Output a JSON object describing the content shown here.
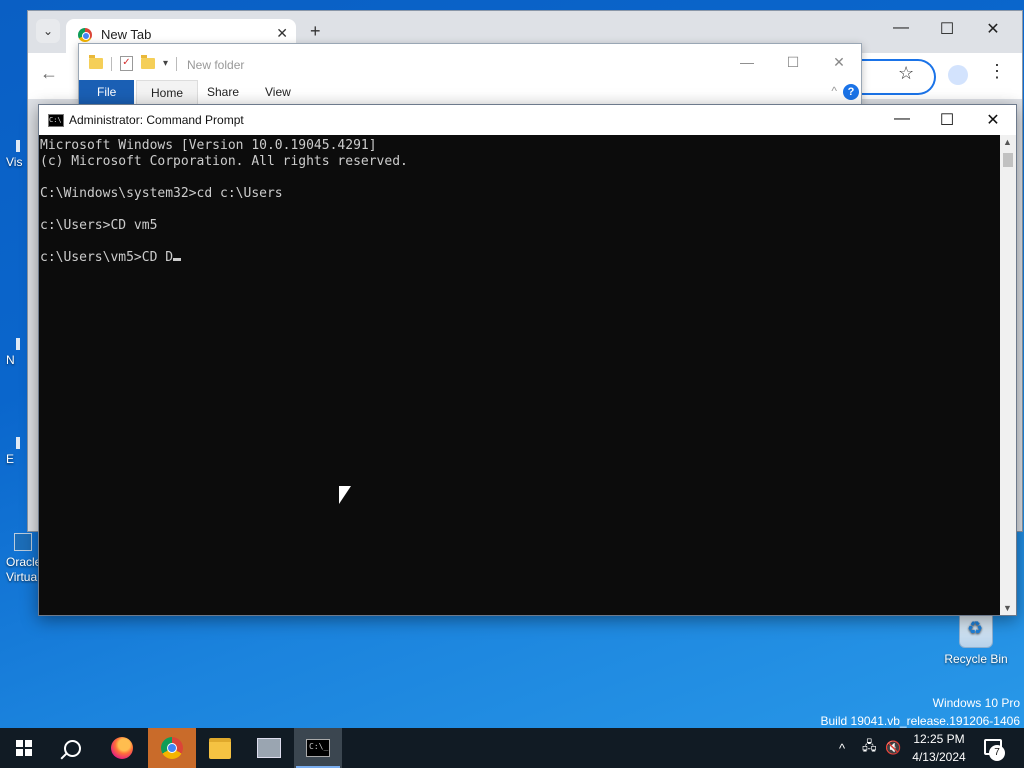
{
  "chrome": {
    "tab_title": "New Tab",
    "tab_close": "✕",
    "new_tab": "+",
    "tab_menu": "⌄",
    "minimize": "—",
    "maximize": "☐",
    "close": "✕",
    "back": "←",
    "star": "☆",
    "profile": "👤",
    "menu": "⋮"
  },
  "explorer": {
    "title": "New folder",
    "minimize": "—",
    "maximize": "☐",
    "close": "✕",
    "ribbon_tabs": [
      "File",
      "Home",
      "Share",
      "View"
    ],
    "collapse": "^",
    "help": "?",
    "dropdown": "▾"
  },
  "cmd": {
    "title": "Administrator: Command Prompt",
    "minimize": "—",
    "maximize": "☐",
    "close": "✕",
    "lines": [
      "Microsoft Windows [Version 10.0.19045.4291]",
      "(c) Microsoft Corporation. All rights reserved.",
      "",
      "C:\\Windows\\system32>cd c:\\Users",
      "",
      "c:\\Users>CD vm5",
      "",
      "c:\\Users\\vm5>CD D"
    ]
  },
  "desktop": {
    "left_fragments": [
      "Vis",
      "N",
      "E"
    ],
    "oracle_label": "Oracle\nVirtua",
    "recycle_bin": "Recycle Bin",
    "watermark_line1": "Windows 10 Pro",
    "watermark_line2": "Build 19041.vb_release.191206-1406"
  },
  "taskbar": {
    "time": "12:25 PM",
    "date": "4/13/2024",
    "notification_count": "7",
    "tray_chevron": "^",
    "apps": [
      "start",
      "search",
      "firefox",
      "chrome",
      "file-explorer",
      "network-app",
      "command-prompt"
    ]
  }
}
